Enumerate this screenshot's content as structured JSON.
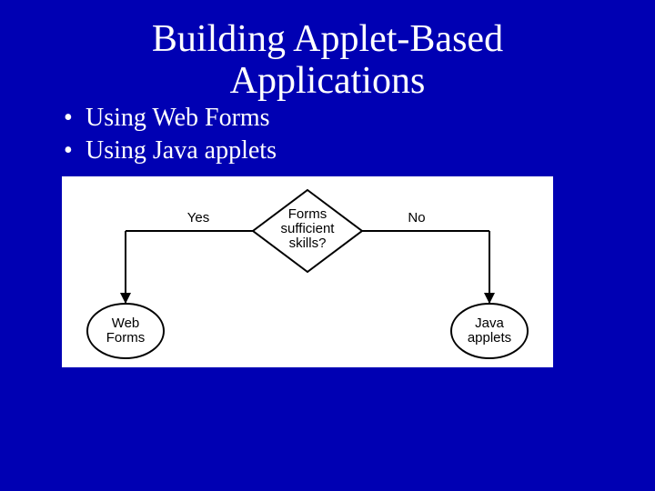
{
  "title_line1": "Building Applet-Based",
  "title_line2": "Applications",
  "bullets": [
    "Using Web Forms",
    "Using Java applets"
  ],
  "diagram": {
    "decision_line1": "Forms",
    "decision_line2": "sufficient",
    "decision_line3": "skills?",
    "yes_label": "Yes",
    "no_label": "No",
    "left_outcome_line1": "Web",
    "left_outcome_line2": "Forms",
    "right_outcome_line1": "Java",
    "right_outcome_line2": "applets"
  }
}
